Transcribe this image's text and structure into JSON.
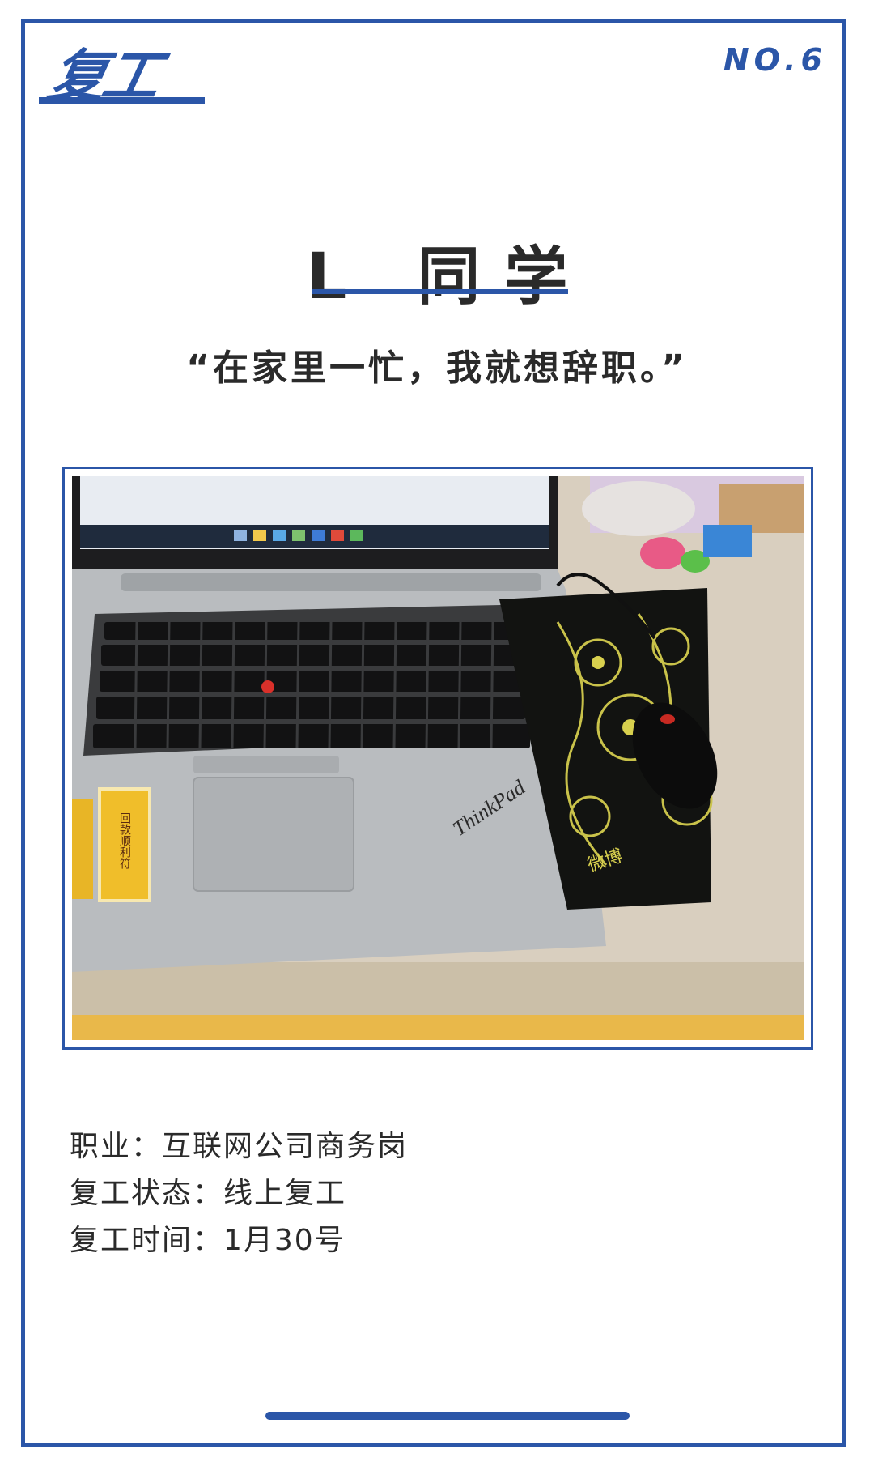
{
  "header": {
    "logo_text": "复工",
    "issue_number": "NO.6"
  },
  "profile": {
    "name": "L 同学",
    "quote": "“在家里一忙，我就想辞职。”"
  },
  "photo": {
    "brand": "ThinkPad",
    "charm_text": "回款顺利符",
    "mousepad_brand": "微博"
  },
  "info": {
    "occupation": "职业：互联网公司商务岗",
    "status": "复工状态：线上复工",
    "date": "复工时间：1月30号"
  },
  "colors": {
    "accent": "#2b56a8",
    "text": "#2a2a2a"
  }
}
